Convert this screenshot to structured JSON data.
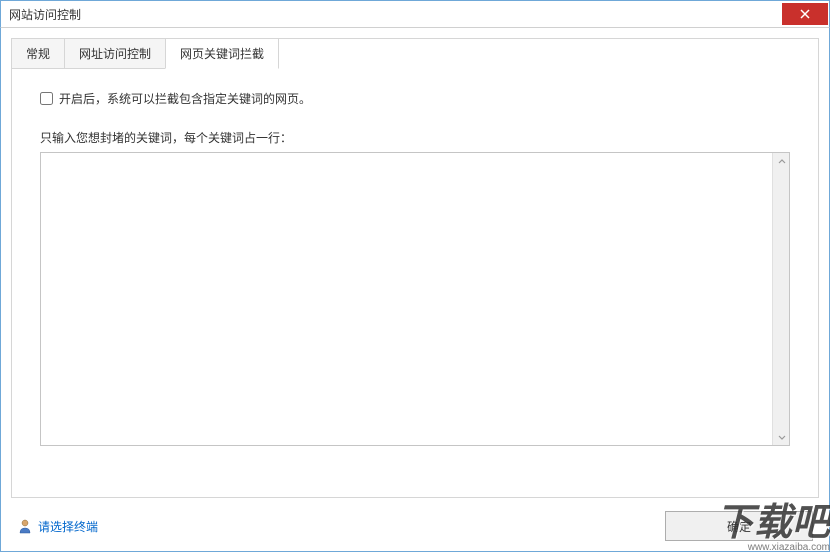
{
  "window": {
    "title": "网站访问控制"
  },
  "tabs": [
    {
      "label": "常规"
    },
    {
      "label": "网址访问控制"
    },
    {
      "label": "网页关键词拦截"
    }
  ],
  "content": {
    "checkbox_label": "开启后，系统可以拦截包含指定关键词的网页。",
    "instruction": "只输入您想封堵的关键词，每个关键词占一行：",
    "textarea_value": ""
  },
  "footer": {
    "link_label": "请选择终端",
    "ok_label": "确定"
  },
  "watermark": {
    "text": "下载吧",
    "url": "www.xiazaiba.com"
  }
}
